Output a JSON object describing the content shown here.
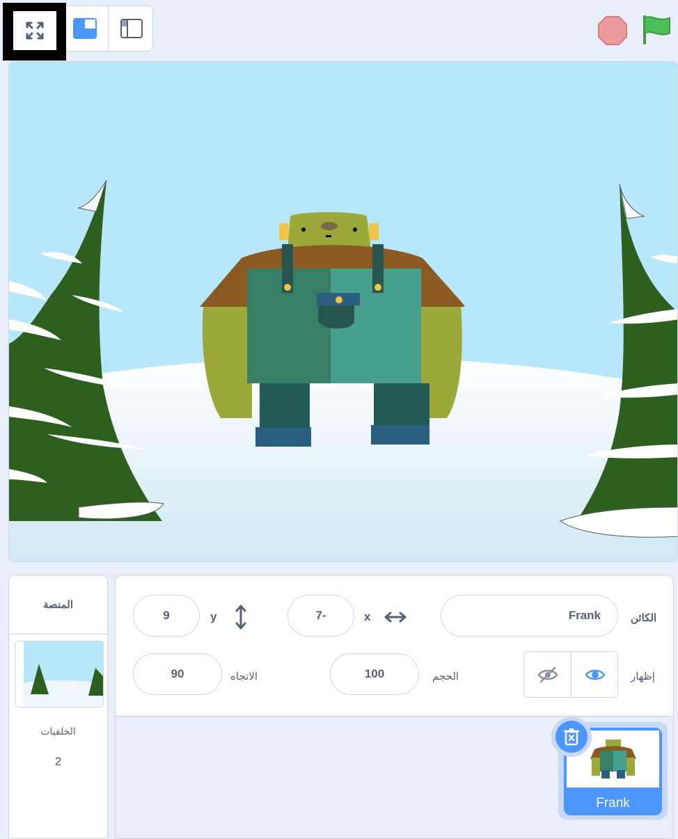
{
  "toolbar": {
    "fullscreen_icon": "fullscreen-icon",
    "small_stage_icon": "small-stage-icon",
    "large_stage_icon": "large-stage-icon",
    "stop_icon": "stop-sign-icon",
    "go_icon": "green-flag-icon"
  },
  "sprite_info": {
    "sprite_label": "الكائن",
    "sprite_name": "Frank",
    "x_label": "x",
    "x_value": "7-",
    "y_label": "y",
    "y_value": "9",
    "show_label": "إظهار",
    "size_label": "الحجم",
    "size_value": "100",
    "direction_label": "الاتجاه",
    "direction_value": "90"
  },
  "stage_panel": {
    "title": "المنصة",
    "backdrops_label": "الخلفيات",
    "backdrops_count": "2"
  },
  "sprite_list": [
    {
      "name": "Frank",
      "selected": true
    }
  ],
  "colors": {
    "accent": "#4c97ff",
    "stage_sky": "#b6e7fa",
    "tree": "#2d5f1e",
    "flag": "#4cbf56",
    "stop": "#ec9c9c"
  }
}
